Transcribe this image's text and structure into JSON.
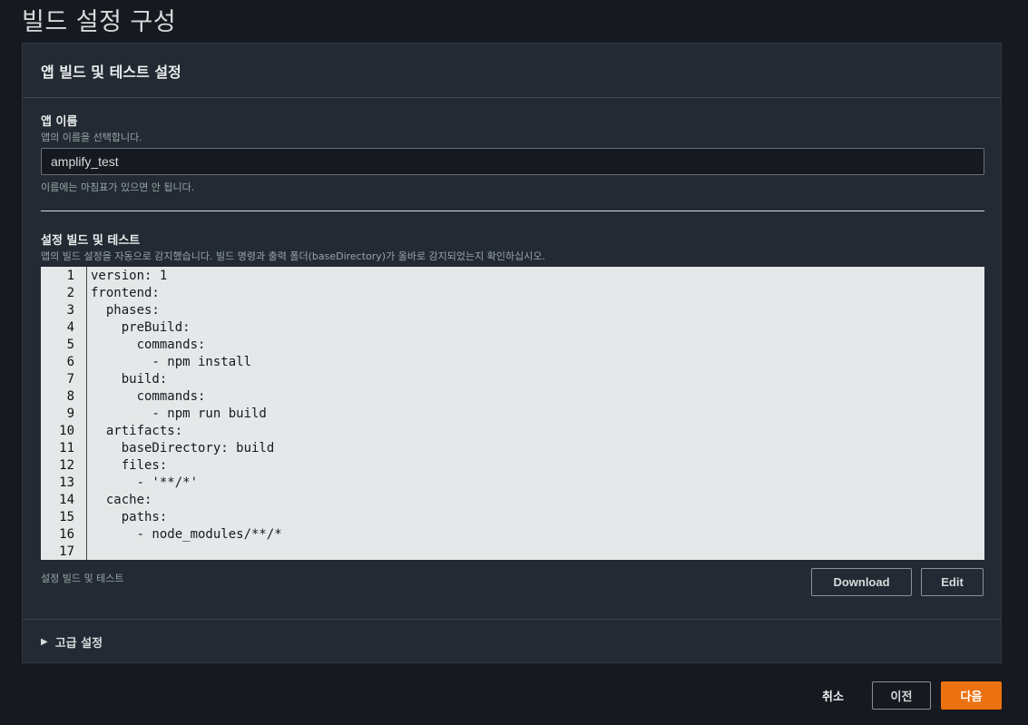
{
  "page_title": "빌드 설정 구성",
  "panel": {
    "title": "앱 빌드 및 테스트 설정",
    "app_name": {
      "label": "앱 이름",
      "description": "앱의 이름을 선택합니다.",
      "value": "amplify_test",
      "hint": "이름에는 마침표가 있으면 안 됩니다."
    },
    "build_settings": {
      "label": "설정 빌드 및 테스트",
      "description": "앱의 빌드 설정을 자동으로 감지했습니다. 빌드 명령과 출력 폴더(baseDirectory)가 올바로 감지되었는지 확인하십시오.",
      "code_lines": [
        {
          "n": "1",
          "text": "version: 1"
        },
        {
          "n": "2",
          "text": "frontend:"
        },
        {
          "n": "3",
          "text": "  phases:"
        },
        {
          "n": "4",
          "text": "    preBuild:"
        },
        {
          "n": "5",
          "text": "      commands:"
        },
        {
          "n": "6",
          "text": "        - npm install"
        },
        {
          "n": "7",
          "text": "    build:"
        },
        {
          "n": "8",
          "text": "      commands:"
        },
        {
          "n": "9",
          "text": "        - npm run build"
        },
        {
          "n": "10",
          "text": "  artifacts:"
        },
        {
          "n": "11",
          "text": "    baseDirectory: build"
        },
        {
          "n": "12",
          "text": "    files:"
        },
        {
          "n": "13",
          "text": "      - '**/*'"
        },
        {
          "n": "14",
          "text": "  cache:"
        },
        {
          "n": "15",
          "text": "    paths:"
        },
        {
          "n": "16",
          "text": "      - node_modules/**/*"
        },
        {
          "n": "17",
          "text": ""
        }
      ],
      "footer_note": "설정 빌드 및 테스트",
      "download_label": "Download",
      "edit_label": "Edit"
    },
    "advanced_label": "고급 설정"
  },
  "actions": {
    "cancel_label": "취소",
    "previous_label": "이전",
    "next_label": "다음"
  },
  "colors": {
    "accent": "#ec7211",
    "background": "#16191f",
    "panel": "#232a33"
  }
}
